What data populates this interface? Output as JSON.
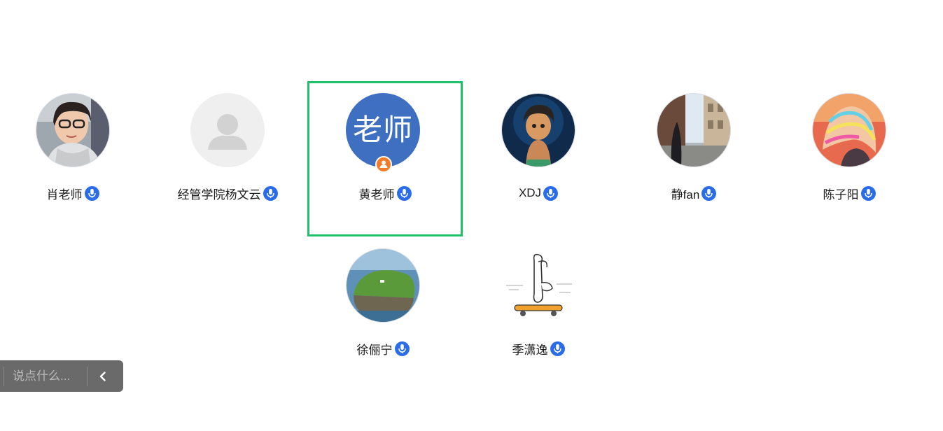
{
  "participants": [
    {
      "name": "肖老师",
      "avatar": "photo-woman-glasses-icon",
      "mic": "mic-icon"
    },
    {
      "name": "经管学院杨文云",
      "avatar": "default-user-icon",
      "mic": "mic-icon"
    },
    {
      "name": "黄老师",
      "avatar_text": "老师",
      "avatar": "text-avatar",
      "role_badge": "host-person-icon",
      "mic": "mic-icon",
      "active": true
    },
    {
      "name": "XDJ",
      "avatar": "cartoon-boy-icon",
      "mic": "mic-icon"
    },
    {
      "name": "静fan",
      "avatar": "street-photo-icon",
      "mic": "mic-icon"
    },
    {
      "name": "陈子阳",
      "avatar": "colorful-hair-photo-icon",
      "mic": "mic-icon"
    },
    {
      "name": "徐俪宁",
      "avatar": "island-photo-icon",
      "mic": "mic-icon"
    },
    {
      "name": "季潇逸",
      "avatar": "skateboard-sketch-icon",
      "mic": "mic-icon"
    }
  ],
  "chat": {
    "placeholder": "说点什么..."
  },
  "colors": {
    "active_border": "#1fc16b",
    "mic_badge": "#2b6de8",
    "host_badge": "#f47b2a",
    "text_avatar_bg": "#3e6fc1",
    "chat_bar_bg": "#6a6a6a"
  }
}
